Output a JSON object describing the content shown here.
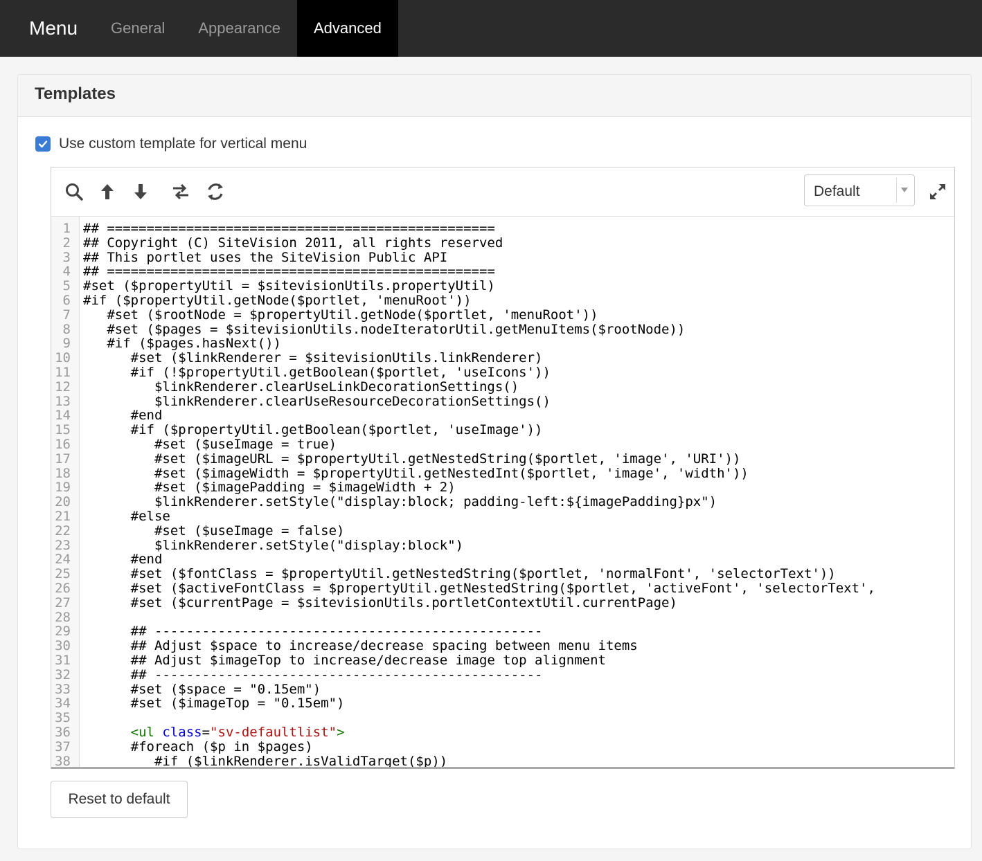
{
  "nav": {
    "brand": "Menu",
    "tabs": [
      {
        "label": "General",
        "active": false
      },
      {
        "label": "Appearance",
        "active": false
      },
      {
        "label": "Advanced",
        "active": true
      }
    ]
  },
  "panel": {
    "title": "Templates",
    "checkbox": {
      "label": "Use custom template for vertical menu",
      "checked": true
    }
  },
  "editor": {
    "toolbar": {
      "icons": [
        "search-icon",
        "arrow-up-icon",
        "arrow-down-icon",
        "swap-icon",
        "refresh-icon"
      ],
      "theme_select": "Default",
      "expand_icon": "expand-icon"
    },
    "lines": [
      {
        "n": "1",
        "text": "## ================================================="
      },
      {
        "n": "2",
        "text": "## Copyright (C) SiteVision 2011, all rights reserved"
      },
      {
        "n": "3",
        "text": "## This portlet uses the SiteVision Public API"
      },
      {
        "n": "4",
        "text": "## ================================================="
      },
      {
        "n": "5",
        "text": "#set ($propertyUtil = $sitevisionUtils.propertyUtil)"
      },
      {
        "n": "6",
        "text": "#if ($propertyUtil.getNode($portlet, 'menuRoot'))"
      },
      {
        "n": "7",
        "text": "   #set ($rootNode = $propertyUtil.getNode($portlet, 'menuRoot'))"
      },
      {
        "n": "8",
        "text": "   #set ($pages = $sitevisionUtils.nodeIteratorUtil.getMenuItems($rootNode))"
      },
      {
        "n": "9",
        "text": "   #if ($pages.hasNext())"
      },
      {
        "n": "10",
        "text": "      #set ($linkRenderer = $sitevisionUtils.linkRenderer)"
      },
      {
        "n": "11",
        "text": "      #if (!$propertyUtil.getBoolean($portlet, 'useIcons'))"
      },
      {
        "n": "12",
        "text": "         $linkRenderer.clearUseLinkDecorationSettings()"
      },
      {
        "n": "13",
        "text": "         $linkRenderer.clearUseResourceDecorationSettings()"
      },
      {
        "n": "14",
        "text": "      #end"
      },
      {
        "n": "15",
        "text": "      #if ($propertyUtil.getBoolean($portlet, 'useImage'))"
      },
      {
        "n": "16",
        "text": "         #set ($useImage = true)"
      },
      {
        "n": "17",
        "text": "         #set ($imageURL = $propertyUtil.getNestedString($portlet, 'image', 'URI'))"
      },
      {
        "n": "18",
        "text": "         #set ($imageWidth = $propertyUtil.getNestedInt($portlet, 'image', 'width'))"
      },
      {
        "n": "19",
        "text": "         #set ($imagePadding = $imageWidth + 2)"
      },
      {
        "n": "20",
        "text": "         $linkRenderer.setStyle(\"display:block; padding-left:${imagePadding}px\")"
      },
      {
        "n": "21",
        "text": "      #else"
      },
      {
        "n": "22",
        "text": "         #set ($useImage = false)"
      },
      {
        "n": "23",
        "text": "         $linkRenderer.setStyle(\"display:block\")"
      },
      {
        "n": "24",
        "text": "      #end"
      },
      {
        "n": "25",
        "text": "      #set ($fontClass = $propertyUtil.getNestedString($portlet, 'normalFont', 'selectorText'))"
      },
      {
        "n": "26",
        "text": "      #set ($activeFontClass = $propertyUtil.getNestedString($portlet, 'activeFont', 'selectorText',"
      },
      {
        "n": "27",
        "text": "      #set ($currentPage = $sitevisionUtils.portletContextUtil.currentPage)"
      },
      {
        "n": "28",
        "text": ""
      },
      {
        "n": "29",
        "text": "      ## -------------------------------------------------"
      },
      {
        "n": "30",
        "text": "      ## Adjust $space to increase/decrease spacing between menu items"
      },
      {
        "n": "31",
        "text": "      ## Adjust $imageTop to increase/decrease image top alignment"
      },
      {
        "n": "32",
        "text": "      ## -------------------------------------------------"
      },
      {
        "n": "33",
        "text": "      #set ($space = \"0.15em\")"
      },
      {
        "n": "34",
        "text": "      #set ($imageTop = \"0.15em\")"
      },
      {
        "n": "35",
        "text": ""
      },
      {
        "n": "36",
        "text": "      ",
        "html": true,
        "parts": [
          "<ul",
          " class",
          "=",
          "\"sv-defaultlist\"",
          ">"
        ]
      },
      {
        "n": "37",
        "text": "      #foreach ($p in $pages)"
      },
      {
        "n": "38",
        "text": "         #if ($linkRenderer.isValidTarget($p))"
      }
    ]
  },
  "buttons": {
    "reset": "Reset to default"
  },
  "colors": {
    "topbar": "#2b2b2b",
    "active_tab": "#000000",
    "checkbox": "#3a7bd5"
  }
}
